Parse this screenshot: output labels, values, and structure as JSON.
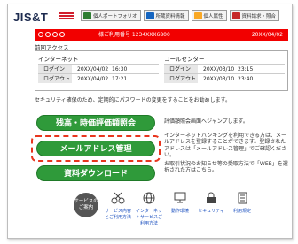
{
  "header": {
    "logo": "JIS&T",
    "tabs": [
      {
        "label": "個人ポートフォリオ",
        "color": "#2e7d32"
      },
      {
        "label": "所蔵資料情報",
        "color": "#1565c0"
      },
      {
        "label": "個人属性",
        "color": "#f9a825"
      },
      {
        "label": "資料請求・照合",
        "color": "#c62828"
      }
    ]
  },
  "banner": {
    "user_id": "様ご利用番号 1234XXX6800",
    "date": "20XX/04/02"
  },
  "access": {
    "title": "前回アクセス",
    "internet": {
      "heading": "インターネット",
      "rows": [
        {
          "label": "ログイン",
          "date": "20XX/04/02",
          "time": "16:30"
        },
        {
          "label": "ログアウト",
          "date": "20XX/04/02",
          "time": "17:21"
        }
      ]
    },
    "callcenter": {
      "heading": "コールセンター",
      "rows": [
        {
          "label": "ログイン",
          "date": "20XX/03/10",
          "time": "23:15"
        },
        {
          "label": "ログアウト",
          "date": "20XX/03/10",
          "time": "23:40"
        }
      ]
    }
  },
  "notice": "セキュリティ確保のため、定期的にパスワードの変更をすることをお勧めします。",
  "buttons": {
    "b1": "残高・時価評価額照会",
    "b2": "メールアドレス管理",
    "b3": "資料ダウンロード"
  },
  "descriptions": {
    "d1": "評価額照会画面へジャンプします。",
    "d2": "インターネットバンキングを利用できる方は、メールアドレスを登録することができます。登録されたアドレスは「メールアドレス管理」でご確認ください。",
    "d3": "お取引状況のお知らせ等の受取方法で「WEB」を選択された方はこちら。"
  },
  "services": {
    "title": "サービスのご案内",
    "items": [
      {
        "label": "サービス内容とご利用方法",
        "icon": "scissors-icon"
      },
      {
        "label": "インターネットサービスご利用方法",
        "icon": "globe-icon"
      },
      {
        "label": "動作環境",
        "icon": "computer-icon"
      },
      {
        "label": "セキュリティ",
        "icon": "lock-icon"
      },
      {
        "label": "利用規定",
        "icon": "document-icon"
      }
    ]
  }
}
